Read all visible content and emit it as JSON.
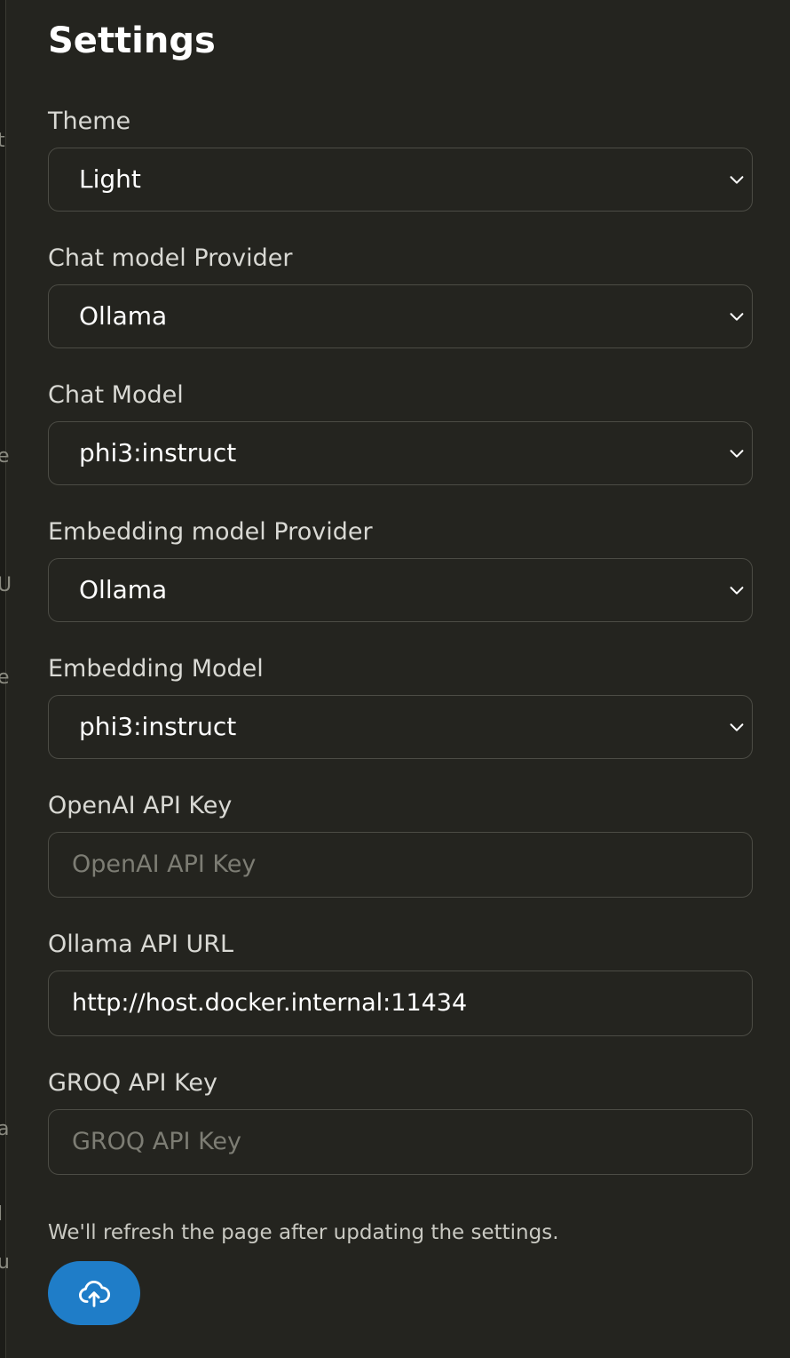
{
  "title": "Settings",
  "fields": {
    "theme": {
      "label": "Theme",
      "value": "Light"
    },
    "chat_provider": {
      "label": "Chat model Provider",
      "value": "Ollama"
    },
    "chat_model": {
      "label": "Chat Model",
      "value": "phi3:instruct"
    },
    "embedding_provider": {
      "label": "Embedding model Provider",
      "value": "Ollama"
    },
    "embedding_model": {
      "label": "Embedding Model",
      "value": "phi3:instruct"
    },
    "openai_key": {
      "label": "OpenAI API Key",
      "value": "",
      "placeholder": "OpenAI API Key"
    },
    "ollama_url": {
      "label": "Ollama API URL",
      "value": "http://host.docker.internal:11434",
      "placeholder": ""
    },
    "groq_key": {
      "label": "GROQ API Key",
      "value": "",
      "placeholder": "GROQ API Key"
    }
  },
  "note": "We'll refresh the page after updating the settings.",
  "save_button": {
    "icon": "cloud-upload-icon"
  },
  "colors": {
    "background": "#24241f",
    "accent": "#1f7dc8",
    "border": "#4c4c45"
  }
}
